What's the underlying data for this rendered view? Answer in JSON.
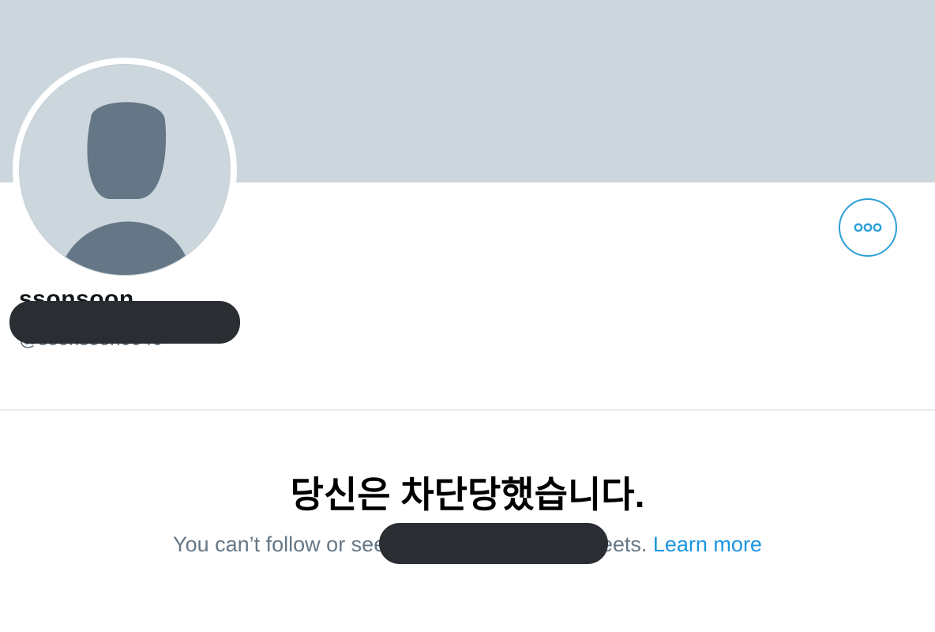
{
  "profile": {
    "display_name": "ssonsoon",
    "screen_name": "@soonsoon0046"
  },
  "more_icon": "more-horizontal-icon",
  "avatar_icon": "default-user-icon",
  "blocked": {
    "title": "당신은 차단당했습니다.",
    "sub_text": "You can’t follow or see @soonsoon0046’s Tweets.",
    "learn_more": "Learn more"
  },
  "colors": {
    "banner": "#ccd6dd",
    "accent": "#1da1f2",
    "secondary_text": "#657786",
    "avatar_silhouette": "#657786"
  }
}
